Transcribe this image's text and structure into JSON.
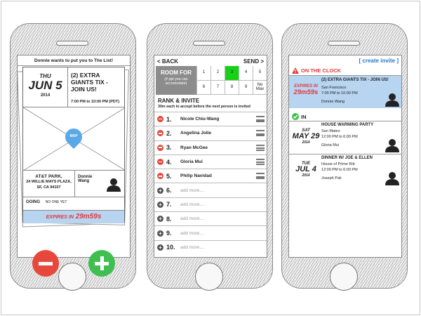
{
  "phone1": {
    "header": "Donnie wants to put you to The List!",
    "day": "THU",
    "date": "JUN 5",
    "year": "2014",
    "event_title": "(2) EXTRA GIANTS TIX - JOIN US!",
    "time": "7:00 PM to 10:00 PM (PDT)",
    "map_label": "MAP",
    "location_lines": [
      "AT&T PARK,",
      "24 WILLIE MAYS PLAZA,",
      "SF, CA 94107"
    ],
    "host_name": [
      "Donnie",
      "Wang"
    ],
    "going_label": "GOING",
    "going_value": "NO ONE YET",
    "expires_label": "EXPIRES IN",
    "expires_value": "29m59s",
    "reject_color": "#e8483b",
    "accept_color": "#3fbf4f"
  },
  "phone2": {
    "back_label": "< BACK",
    "send_label": "SEND >",
    "room_label": "ROOM FOR",
    "room_sub": "(# ppl you can accomodate)",
    "room_options": [
      "1",
      "2",
      "3",
      "4",
      "5",
      "6",
      "7",
      "8",
      "9",
      "No Max"
    ],
    "room_selected": "3",
    "rank_title": "RANK & INVITE",
    "rank_sub": "30m each to accept before the next person is invited",
    "invitees": [
      {
        "num": "1.",
        "name": "Nicole Chiu-Wang"
      },
      {
        "num": "2.",
        "name": "Angelina Jolie"
      },
      {
        "num": "3.",
        "name": "Ryan McGee"
      },
      {
        "num": "4.",
        "name": "Gloria Mui"
      },
      {
        "num": "5.",
        "name": "Philip Navidad"
      }
    ],
    "empty_slots": [
      {
        "num": "6.",
        "text": "add more...."
      },
      {
        "num": "7.",
        "text": "add more...."
      },
      {
        "num": "8.",
        "text": "add more...."
      },
      {
        "num": "9.",
        "text": "add more...."
      },
      {
        "num": "10.",
        "text": "add more...."
      }
    ]
  },
  "phone3": {
    "create_invite": "[ create invite ]",
    "on_clock_label": "ON THE CLOCK",
    "on_clock_event": {
      "title": "(2) EXTRA GIANTS TIX - JOIN US!",
      "expires_label": "EXPIRES IN",
      "expires_value": "29m59s",
      "city": "San Francisco",
      "time": "7:00 PM to 10:00 PM",
      "host": "Donnie Wang"
    },
    "in_label": "IN",
    "in_events": [
      {
        "title": "HOUSE WARMING PARTY",
        "day": "SAT",
        "date": "MAY 29",
        "year": "2014",
        "place": "San Mateo",
        "time": "12:00 PM to 6:00 PM",
        "host": "Gloria Mui"
      },
      {
        "title": "DINNER W/ JOE & ELLEN",
        "day": "TUE",
        "date": "JUL 4",
        "year": "2014",
        "place": "House of Prime Rib",
        "time": "12:00 PM to 6:00 PM",
        "host": "Joseph Pak"
      }
    ]
  }
}
